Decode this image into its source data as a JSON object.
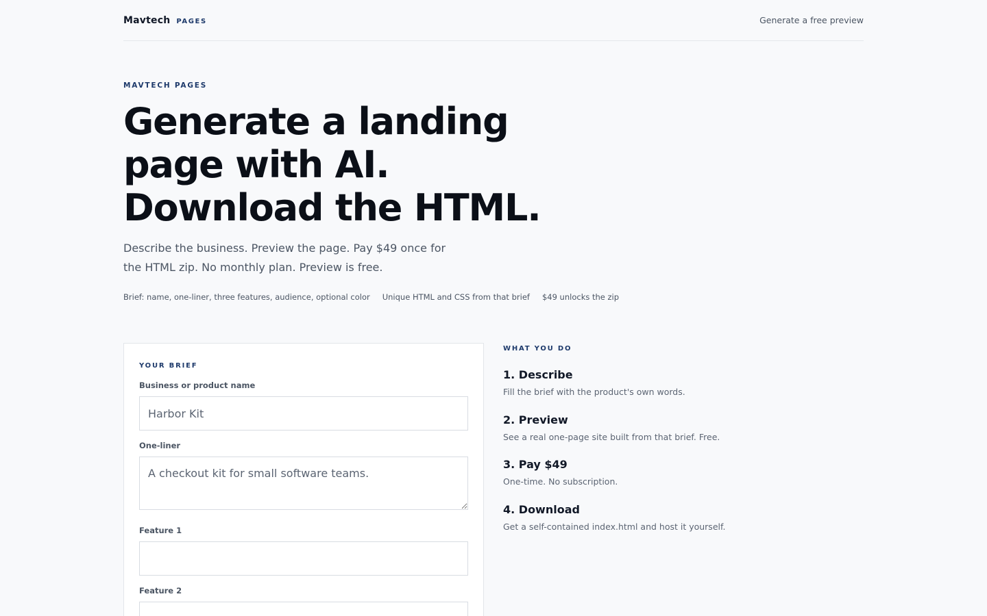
{
  "header": {
    "brand_name": "Mavtech",
    "brand_tag": "PAGES",
    "nav_link": "Generate a free preview"
  },
  "hero": {
    "eyebrow": "MAVTECH PAGES",
    "title_line1": "Generate a landing",
    "title_line2": "page with AI.",
    "title_line3": "Download the HTML.",
    "subtitle": "Describe the business. Preview the page. Pay $49 once for the HTML zip. No monthly plan. Preview is free.",
    "chips": [
      "Brief: name, one-liner, three features, audience, optional color",
      "Unique HTML and CSS from that brief",
      "$49 unlocks the zip"
    ]
  },
  "form": {
    "eyebrow": "YOUR BRIEF",
    "name_label": "Business or product name",
    "name_placeholder": "Harbor Kit",
    "oneliner_label": "One-liner",
    "oneliner_placeholder": "A checkout kit for small software teams.",
    "feature1_label": "Feature 1",
    "feature2_label": "Feature 2"
  },
  "steps": {
    "eyebrow": "WHAT YOU DO",
    "items": [
      {
        "title": "1. Describe",
        "desc": "Fill the brief with the product's own words."
      },
      {
        "title": "2. Preview",
        "desc": "See a real one-page site built from that brief. Free."
      },
      {
        "title": "3. Pay $49",
        "desc": "One-time. No subscription."
      },
      {
        "title": "4. Download",
        "desc": "Get a self-contained index.html and host it yourself."
      }
    ]
  },
  "colors": {
    "accent": "#1e3a6b",
    "background": "#f8f9fb",
    "text": "#111827"
  }
}
